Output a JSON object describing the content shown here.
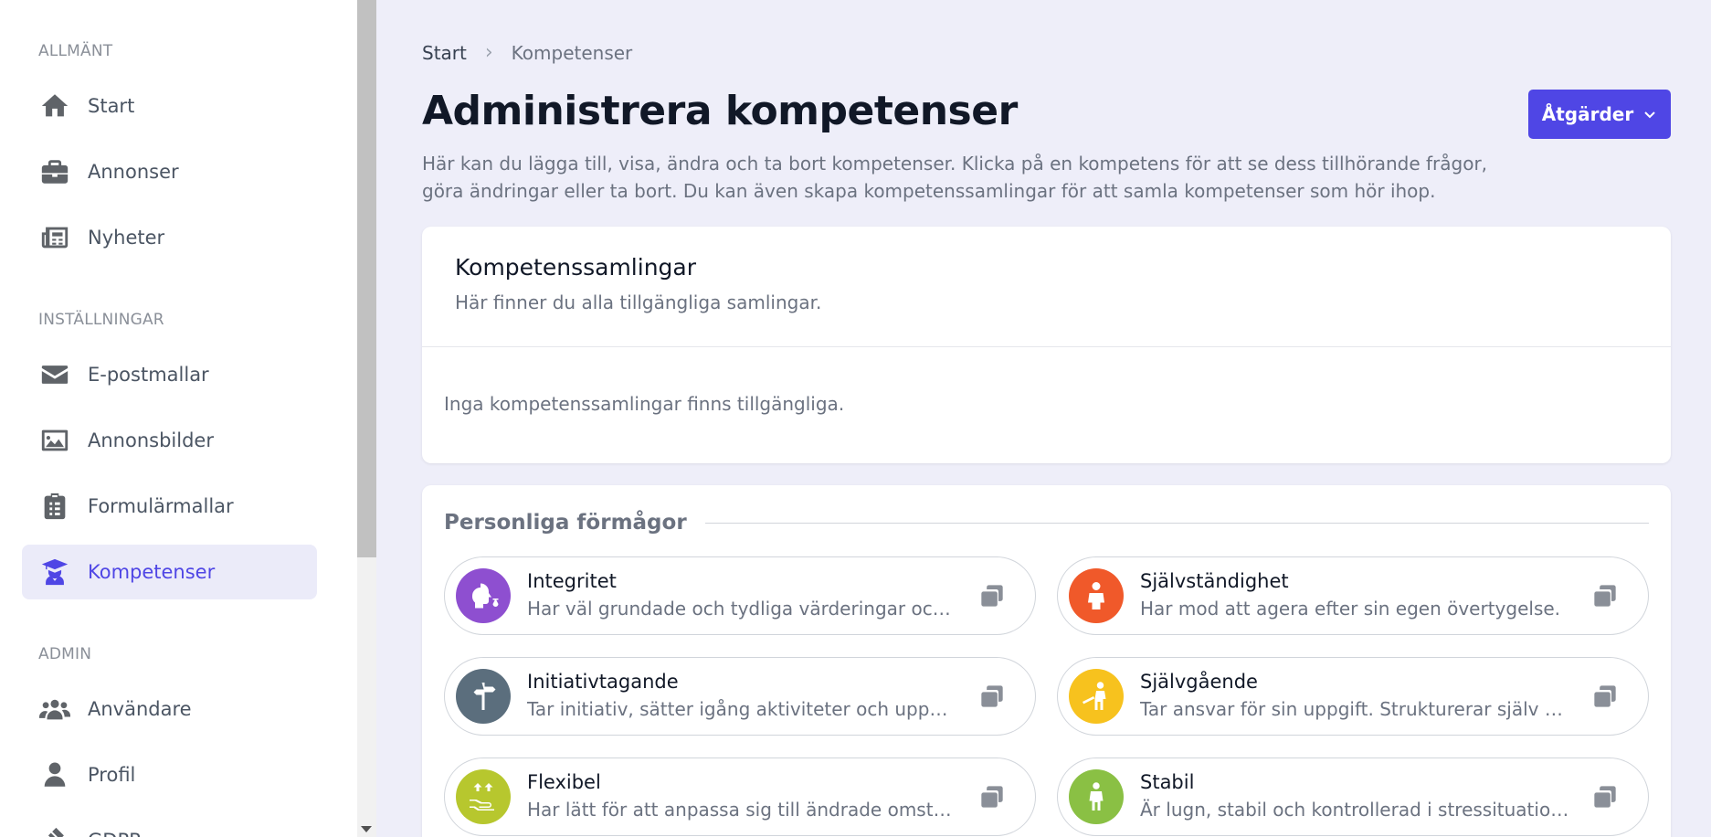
{
  "sidebar": {
    "sections": [
      {
        "label": "ALLMÄNT"
      },
      {
        "label": "INSTÄLLNINGAR"
      },
      {
        "label": "ADMIN"
      }
    ],
    "items": [
      {
        "label": "Start",
        "icon": "home-icon"
      },
      {
        "label": "Annonser",
        "icon": "briefcase-icon"
      },
      {
        "label": "Nyheter",
        "icon": "newspaper-icon"
      },
      {
        "label": "E-postmallar",
        "icon": "envelope-icon"
      },
      {
        "label": "Annonsbilder",
        "icon": "image-icon"
      },
      {
        "label": "Formulärmallar",
        "icon": "clipboard-list-icon"
      },
      {
        "label": "Kompetenser",
        "icon": "graduate-icon",
        "active": true
      },
      {
        "label": "Användare",
        "icon": "users-icon"
      },
      {
        "label": "Profil",
        "icon": "user-icon"
      },
      {
        "label": "GDPR",
        "icon": "gavel-icon"
      }
    ]
  },
  "breadcrumb": {
    "start": "Start",
    "separator": "›",
    "current": "Kompetenser"
  },
  "header": {
    "title": "Administrera kompetenser",
    "description": "Här kan du lägga till, visa, ändra och ta bort kompetenser. Klicka på en kompetens för att se dess tillhörande frågor, göra ändringar eller ta bort. Du kan även skapa kompetenssamlingar för att samla kompetenser som hör ihop.",
    "actions_label": "Åtgärder"
  },
  "collections": {
    "title": "Kompetenssamlingar",
    "subtitle": "Här finner du alla tillgängliga samlingar.",
    "empty": "Inga kompetenssamlingar finns tillgängliga."
  },
  "groups": [
    {
      "title": "Personliga förmågor",
      "competences": [
        {
          "name": "Integritet",
          "desc": "Har väl grundade och tydliga värderingar och står för dem.",
          "color": "#8e4fd0",
          "icon": "head-scales-icon"
        },
        {
          "name": "Självständighet",
          "desc": "Har mod att agera efter sin egen övertygelse.",
          "color": "#f0592a",
          "icon": "person-heart-icon"
        },
        {
          "name": "Initiativtagande",
          "desc": "Tar initiativ, sätter igång aktiviteter och uppnår resultat.",
          "color": "#5b6e7d",
          "icon": "signpost-icon"
        },
        {
          "name": "Självgående",
          "desc": "Tar ansvar för sin uppgift. Strukturerar själv sitt arbete.",
          "color": "#f7c21e",
          "icon": "person-work-icon"
        },
        {
          "name": "Flexibel",
          "desc": "Har lätt för att anpassa sig till ändrade omständigheter.",
          "color": "#b7c72e",
          "icon": "hand-arrows-icon"
        },
        {
          "name": "Stabil",
          "desc": "Är lugn, stabil och kontrollerad i stressituationer.",
          "color": "#8ac044",
          "icon": "person-stand-icon"
        }
      ]
    }
  ]
}
